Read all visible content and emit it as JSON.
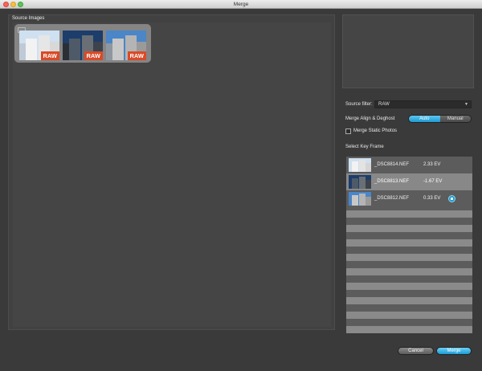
{
  "window": {
    "title": "Merge"
  },
  "source": {
    "label": "Source Images",
    "thumbnails": [
      {
        "badge": "RAW"
      },
      {
        "badge": "RAW"
      },
      {
        "badge": "RAW"
      }
    ]
  },
  "settings": {
    "filter_label": "Source filter:",
    "filter_value": "RAW",
    "align_label": "Merge Align & Deghost",
    "align_options": [
      "Auto",
      "Manual"
    ],
    "align_selected": "Auto",
    "static_label": "Merge Static Photos",
    "static_checked": false
  },
  "keyframe": {
    "label": "Select Key Frame",
    "rows": [
      {
        "file": "_DSC8814.NEF",
        "ev": "2.33 EV"
      },
      {
        "file": "_DSC8813.NEF",
        "ev": "-1.67 EV"
      },
      {
        "file": "_DSC8812.NEF",
        "ev": "0.33 EV"
      }
    ]
  },
  "buttons": {
    "cancel": "Cancel",
    "merge": "Merge"
  },
  "colors": {
    "accent": "#1d9bd2",
    "raw_badge": "#d94a28",
    "background": "#3a3a3a"
  }
}
